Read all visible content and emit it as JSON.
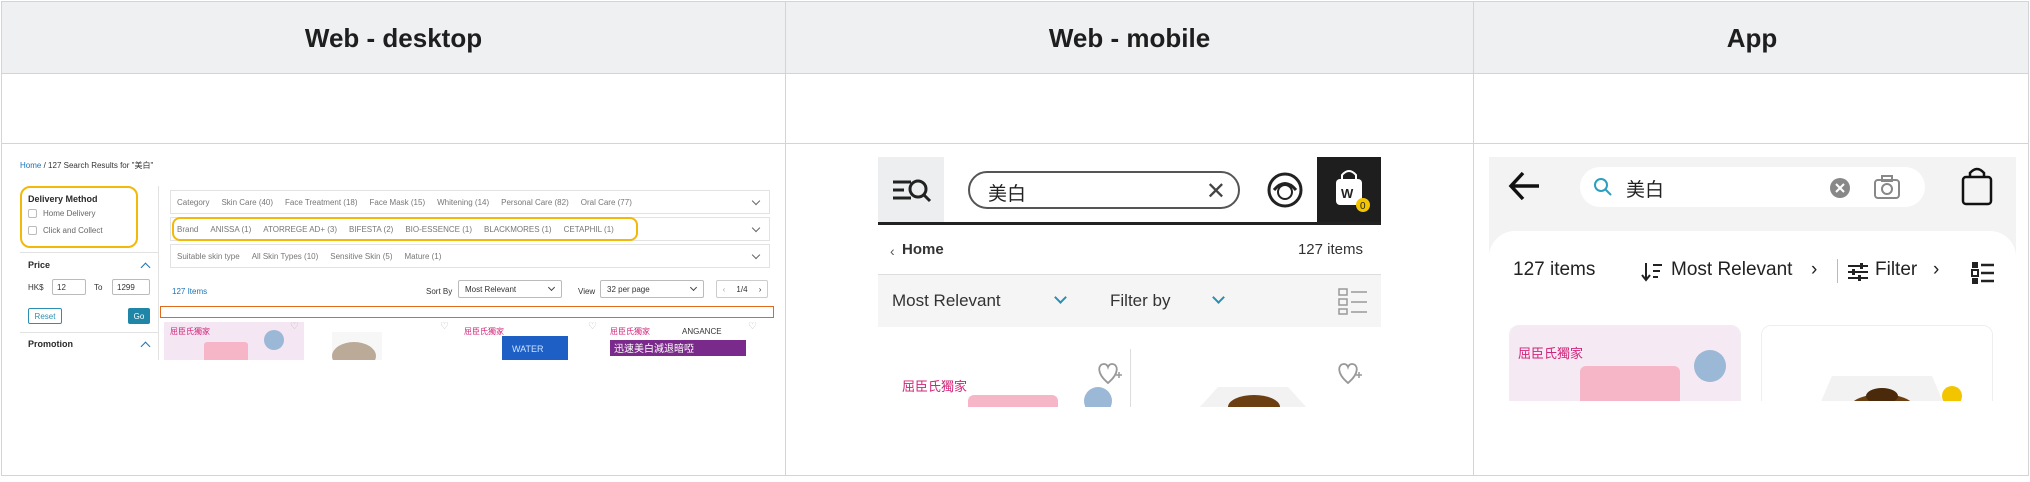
{
  "table": {
    "headers": [
      "Web - desktop",
      "Web - mobile",
      "App"
    ]
  },
  "desktop": {
    "breadcrumb": {
      "home": "Home",
      "separator": "/",
      "result_text": "127 Search Results for \"美白\""
    },
    "sidebar": {
      "delivery_title": "Delivery Method",
      "delivery_options": [
        "Home Delivery",
        "Click and Collect"
      ],
      "price_title": "Price",
      "currency": "HK$",
      "price_from": "12",
      "to_label": "To",
      "price_to": "1299",
      "reset_label": "Reset",
      "go_label": "Go",
      "promotion_title": "Promotion"
    },
    "filters": {
      "category": [
        "Category",
        "Skin Care (40)",
        "Face Treatment (18)",
        "Face Mask (15)",
        "Whitening (14)",
        "Personal Care (82)",
        "Oral Care (77)"
      ],
      "brand": [
        "Brand",
        "ANISSA (1)",
        "ATORREGE AD+ (3)",
        "BIFESTA (2)",
        "BIO-ESSENCE (1)",
        "BLACKMORES (1)",
        "CETAPHIL (1)"
      ],
      "skin_type": [
        "Suitable skin type",
        "All Skin Types (10)",
        "Sensitive Skin (5)",
        "Mature (1)"
      ]
    },
    "toolbar": {
      "items_count": "127 Items",
      "sort_label": "Sort By",
      "sort_value": "Most Relevant",
      "view_label": "View",
      "view_value": "32 per page",
      "page_current": "1",
      "page_total": "/4"
    },
    "product_snippets": [
      "屈臣氏獨家",
      "WATER",
      "迅速美白減退暗啞",
      "ANGANCE"
    ]
  },
  "mobile": {
    "search_value": "美白",
    "bag_count": "0",
    "breadcrumb_home": "Home",
    "items_count": "127 items",
    "sort_label": "Most Relevant",
    "filter_label": "Filter by",
    "product_snippet": "屈臣氏獨家"
  },
  "app": {
    "search_value": "美白",
    "items_count": "127 items",
    "sort_label": "Most Relevant",
    "filter_label": "Filter",
    "product_snippet": "屈臣氏獨家"
  },
  "colors": {
    "highlight_yellow": "#f2b90a",
    "highlight_orange": "#e06a1c",
    "link_blue": "#1a73b8",
    "teal": "#1f86a8"
  }
}
